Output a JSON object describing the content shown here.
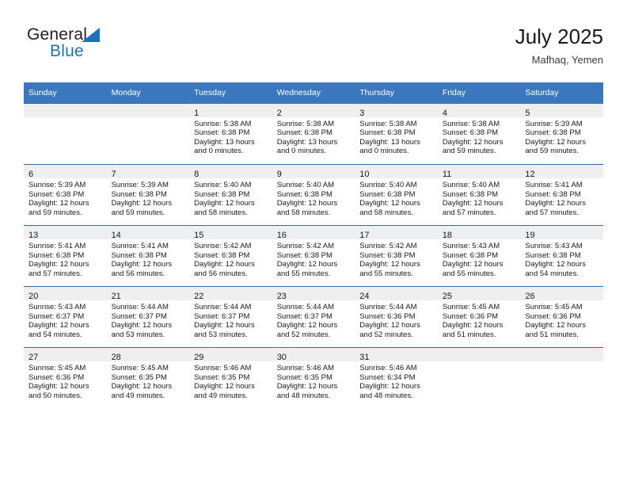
{
  "brand": {
    "name_part1": "General",
    "name_part2": "Blue",
    "triangle_color": "#1b72bb"
  },
  "header": {
    "title": "July 2025",
    "subtitle": "Mafhaq, Yemen"
  },
  "theme": {
    "header_blue": "#3a77bd",
    "row_divider_blue": "#2f6ca8",
    "daynum_band": "#efefef"
  },
  "calendar": {
    "weekday_headers": [
      "Sunday",
      "Monday",
      "Tuesday",
      "Wednesday",
      "Thursday",
      "Friday",
      "Saturday"
    ],
    "labels": {
      "sunrise_prefix": "Sunrise:",
      "sunset_prefix": "Sunset:",
      "daylight_prefix": "Daylight:"
    },
    "weeks": [
      [
        {
          "empty": true
        },
        {
          "empty": true
        },
        {
          "day": "1",
          "sunrise": "Sunrise: 5:38 AM",
          "sunset": "Sunset: 6:38 PM",
          "daylight_l1": "Daylight: 13 hours",
          "daylight_l2": "and 0 minutes."
        },
        {
          "day": "2",
          "sunrise": "Sunrise: 5:38 AM",
          "sunset": "Sunset: 6:38 PM",
          "daylight_l1": "Daylight: 13 hours",
          "daylight_l2": "and 0 minutes."
        },
        {
          "day": "3",
          "sunrise": "Sunrise: 5:38 AM",
          "sunset": "Sunset: 6:38 PM",
          "daylight_l1": "Daylight: 13 hours",
          "daylight_l2": "and 0 minutes."
        },
        {
          "day": "4",
          "sunrise": "Sunrise: 5:38 AM",
          "sunset": "Sunset: 6:38 PM",
          "daylight_l1": "Daylight: 12 hours",
          "daylight_l2": "and 59 minutes."
        },
        {
          "day": "5",
          "sunrise": "Sunrise: 5:39 AM",
          "sunset": "Sunset: 6:38 PM",
          "daylight_l1": "Daylight: 12 hours",
          "daylight_l2": "and 59 minutes."
        }
      ],
      [
        {
          "day": "6",
          "sunrise": "Sunrise: 5:39 AM",
          "sunset": "Sunset: 6:38 PM",
          "daylight_l1": "Daylight: 12 hours",
          "daylight_l2": "and 59 minutes."
        },
        {
          "day": "7",
          "sunrise": "Sunrise: 5:39 AM",
          "sunset": "Sunset: 6:38 PM",
          "daylight_l1": "Daylight: 12 hours",
          "daylight_l2": "and 59 minutes."
        },
        {
          "day": "8",
          "sunrise": "Sunrise: 5:40 AM",
          "sunset": "Sunset: 6:38 PM",
          "daylight_l1": "Daylight: 12 hours",
          "daylight_l2": "and 58 minutes."
        },
        {
          "day": "9",
          "sunrise": "Sunrise: 5:40 AM",
          "sunset": "Sunset: 6:38 PM",
          "daylight_l1": "Daylight: 12 hours",
          "daylight_l2": "and 58 minutes."
        },
        {
          "day": "10",
          "sunrise": "Sunrise: 5:40 AM",
          "sunset": "Sunset: 6:38 PM",
          "daylight_l1": "Daylight: 12 hours",
          "daylight_l2": "and 58 minutes."
        },
        {
          "day": "11",
          "sunrise": "Sunrise: 5:40 AM",
          "sunset": "Sunset: 6:38 PM",
          "daylight_l1": "Daylight: 12 hours",
          "daylight_l2": "and 57 minutes."
        },
        {
          "day": "12",
          "sunrise": "Sunrise: 5:41 AM",
          "sunset": "Sunset: 6:38 PM",
          "daylight_l1": "Daylight: 12 hours",
          "daylight_l2": "and 57 minutes."
        }
      ],
      [
        {
          "day": "13",
          "sunrise": "Sunrise: 5:41 AM",
          "sunset": "Sunset: 6:38 PM",
          "daylight_l1": "Daylight: 12 hours",
          "daylight_l2": "and 57 minutes."
        },
        {
          "day": "14",
          "sunrise": "Sunrise: 5:41 AM",
          "sunset": "Sunset: 6:38 PM",
          "daylight_l1": "Daylight: 12 hours",
          "daylight_l2": "and 56 minutes."
        },
        {
          "day": "15",
          "sunrise": "Sunrise: 5:42 AM",
          "sunset": "Sunset: 6:38 PM",
          "daylight_l1": "Daylight: 12 hours",
          "daylight_l2": "and 56 minutes."
        },
        {
          "day": "16",
          "sunrise": "Sunrise: 5:42 AM",
          "sunset": "Sunset: 6:38 PM",
          "daylight_l1": "Daylight: 12 hours",
          "daylight_l2": "and 55 minutes."
        },
        {
          "day": "17",
          "sunrise": "Sunrise: 5:42 AM",
          "sunset": "Sunset: 6:38 PM",
          "daylight_l1": "Daylight: 12 hours",
          "daylight_l2": "and 55 minutes."
        },
        {
          "day": "18",
          "sunrise": "Sunrise: 5:43 AM",
          "sunset": "Sunset: 6:38 PM",
          "daylight_l1": "Daylight: 12 hours",
          "daylight_l2": "and 55 minutes."
        },
        {
          "day": "19",
          "sunrise": "Sunrise: 5:43 AM",
          "sunset": "Sunset: 6:38 PM",
          "daylight_l1": "Daylight: 12 hours",
          "daylight_l2": "and 54 minutes."
        }
      ],
      [
        {
          "day": "20",
          "sunrise": "Sunrise: 5:43 AM",
          "sunset": "Sunset: 6:37 PM",
          "daylight_l1": "Daylight: 12 hours",
          "daylight_l2": "and 54 minutes."
        },
        {
          "day": "21",
          "sunrise": "Sunrise: 5:44 AM",
          "sunset": "Sunset: 6:37 PM",
          "daylight_l1": "Daylight: 12 hours",
          "daylight_l2": "and 53 minutes."
        },
        {
          "day": "22",
          "sunrise": "Sunrise: 5:44 AM",
          "sunset": "Sunset: 6:37 PM",
          "daylight_l1": "Daylight: 12 hours",
          "daylight_l2": "and 53 minutes."
        },
        {
          "day": "23",
          "sunrise": "Sunrise: 5:44 AM",
          "sunset": "Sunset: 6:37 PM",
          "daylight_l1": "Daylight: 12 hours",
          "daylight_l2": "and 52 minutes."
        },
        {
          "day": "24",
          "sunrise": "Sunrise: 5:44 AM",
          "sunset": "Sunset: 6:36 PM",
          "daylight_l1": "Daylight: 12 hours",
          "daylight_l2": "and 52 minutes."
        },
        {
          "day": "25",
          "sunrise": "Sunrise: 5:45 AM",
          "sunset": "Sunset: 6:36 PM",
          "daylight_l1": "Daylight: 12 hours",
          "daylight_l2": "and 51 minutes."
        },
        {
          "day": "26",
          "sunrise": "Sunrise: 5:45 AM",
          "sunset": "Sunset: 6:36 PM",
          "daylight_l1": "Daylight: 12 hours",
          "daylight_l2": "and 51 minutes."
        }
      ],
      [
        {
          "day": "27",
          "sunrise": "Sunrise: 5:45 AM",
          "sunset": "Sunset: 6:36 PM",
          "daylight_l1": "Daylight: 12 hours",
          "daylight_l2": "and 50 minutes."
        },
        {
          "day": "28",
          "sunrise": "Sunrise: 5:45 AM",
          "sunset": "Sunset: 6:35 PM",
          "daylight_l1": "Daylight: 12 hours",
          "daylight_l2": "and 49 minutes."
        },
        {
          "day": "29",
          "sunrise": "Sunrise: 5:46 AM",
          "sunset": "Sunset: 6:35 PM",
          "daylight_l1": "Daylight: 12 hours",
          "daylight_l2": "and 49 minutes."
        },
        {
          "day": "30",
          "sunrise": "Sunrise: 5:46 AM",
          "sunset": "Sunset: 6:35 PM",
          "daylight_l1": "Daylight: 12 hours",
          "daylight_l2": "and 48 minutes."
        },
        {
          "day": "31",
          "sunrise": "Sunrise: 5:46 AM",
          "sunset": "Sunset: 6:34 PM",
          "daylight_l1": "Daylight: 12 hours",
          "daylight_l2": "and 48 minutes."
        },
        {
          "empty": true
        },
        {
          "empty": true
        }
      ]
    ]
  }
}
